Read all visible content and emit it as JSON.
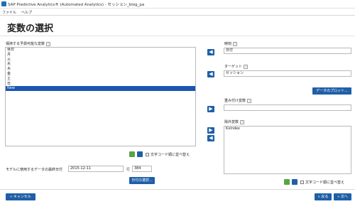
{
  "window": {
    "title": "SAP Predictive Analytics® (Automated Analytics) - セッション_blog_pa"
  },
  "menu": {
    "file": "ファイル",
    "help": "ヘルプ"
  },
  "page": {
    "title": "変数の選択"
  },
  "left": {
    "available_label": "保持する予測可能な変数",
    "available_items": [
      "休日",
      "月",
      "火",
      "水",
      "木",
      "金",
      "土",
      "日",
      "New"
    ],
    "selected_item": "New",
    "sort_label": "文字コード順に並べ替え",
    "last_date_label": "モデルに使用するデータの最終日付",
    "last_date_value": "2015-12-11",
    "row_label": "行",
    "row_value": "384",
    "date_select_button": "日付の選択..."
  },
  "right": {
    "time_label": "時刻",
    "time_value": "日付",
    "target_label": "ターゲット",
    "target_value": "セッション",
    "data_plot_button": "データのプロット...",
    "weight_label": "重み付け変数",
    "weight_value": "",
    "excluded_label": "除外変数",
    "excluded_items": [
      "KxIndex"
    ],
    "sort_label": "文字コード順に並べ替え"
  },
  "footer": {
    "cancel_button": "キャンセル",
    "back_button": "戻る",
    "next_button": "次へ"
  },
  "icons": {
    "arrow_left": "◀",
    "arrow_right": "▶",
    "info": "i"
  },
  "colors": {
    "accent": "#1f5fa8",
    "selection": "#1a56b0"
  }
}
